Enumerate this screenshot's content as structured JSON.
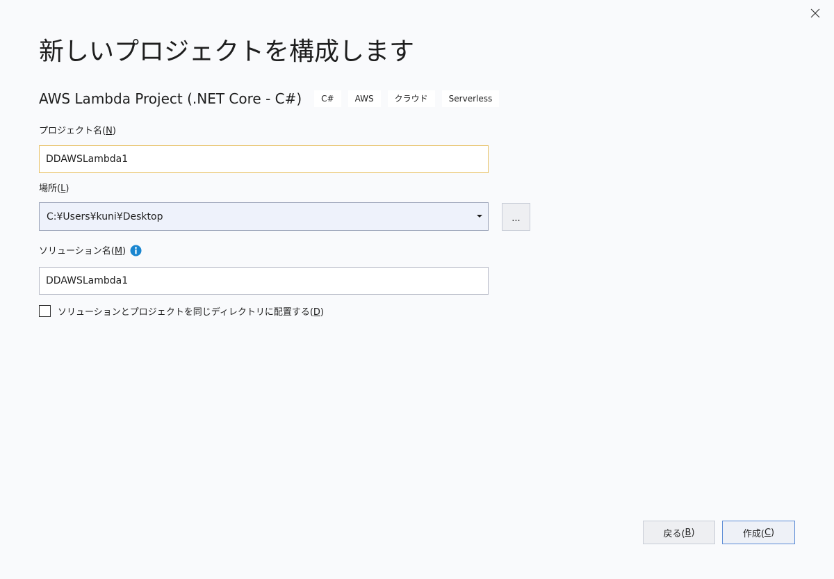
{
  "dialog": {
    "title": "新しいプロジェクトを構成します"
  },
  "template": {
    "name": "AWS Lambda Project (.NET Core - C#)",
    "tags": [
      "C#",
      "AWS",
      "クラウド",
      "Serverless"
    ]
  },
  "project_name": {
    "label": "プロジェクト名(",
    "accesskey": "N",
    "label_end": ")",
    "value": "DDAWSLambda1"
  },
  "location": {
    "label": "場所(",
    "accesskey": "L",
    "label_end": ")",
    "value": "C:¥Users¥kuni¥Desktop",
    "browse_label": "..."
  },
  "solution_name": {
    "label": "ソリューション名(",
    "accesskey": "M",
    "label_end": ")",
    "value": "DDAWSLambda1"
  },
  "same_dir": {
    "label": "ソリューションとプロジェクトを同じディレクトリに配置する(",
    "accesskey": "D",
    "label_end": ")",
    "checked": false
  },
  "buttons": {
    "back": {
      "label": "戻る(",
      "accesskey": "B",
      "label_end": ")"
    },
    "create": {
      "label": "作成(",
      "accesskey": "C",
      "label_end": ")"
    }
  },
  "colors": {
    "focus_border": "#e8c36a",
    "info_icon": "#1a86d0",
    "primary_border": "#5a8bd6"
  }
}
